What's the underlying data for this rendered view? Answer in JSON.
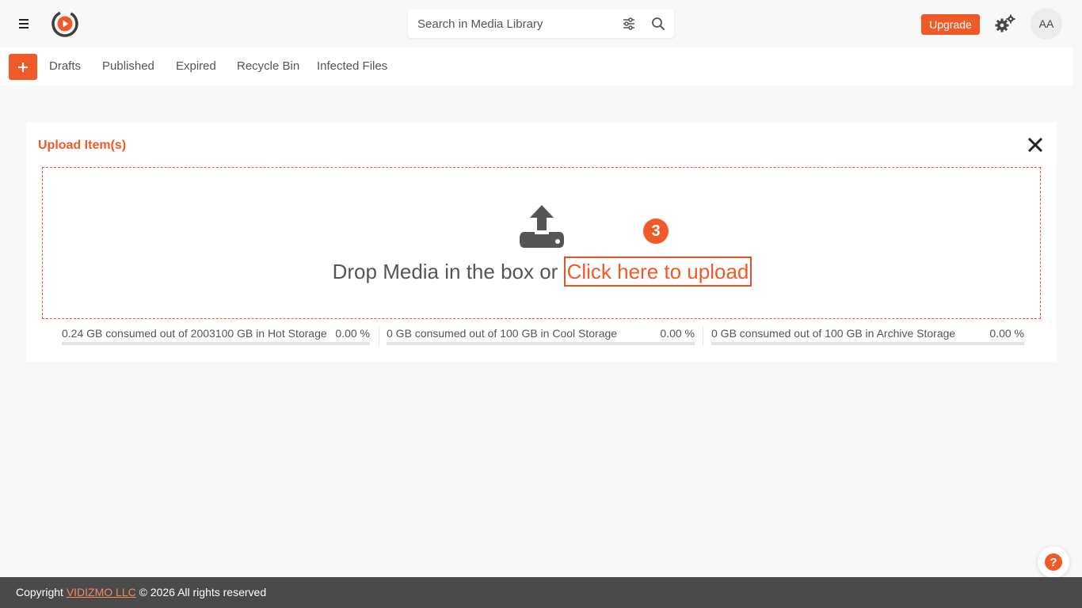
{
  "header": {
    "search": {
      "placeholder": "Search in Media Library"
    },
    "upgrade_label": "Upgrade",
    "avatar_initials": "AA"
  },
  "tabs": [
    {
      "label": "Drafts"
    },
    {
      "label": "Published"
    },
    {
      "label": "Expired"
    },
    {
      "label": "Recycle Bin"
    },
    {
      "label": "Infected Files"
    }
  ],
  "upload_panel": {
    "title": "Upload Item(s)",
    "drop_text": "Drop Media in the box or ",
    "upload_link": "Click here to upload",
    "step_number": "3"
  },
  "storage": [
    {
      "label": "0.24 GB consumed out of 2003100 GB in Hot Storage",
      "percent": "0.00 %",
      "fill_fraction": 0.0
    },
    {
      "label": "0 GB consumed out of 100 GB in Cool Storage",
      "percent": "0.00 %",
      "fill_fraction": 0.0
    },
    {
      "label": "0 GB consumed out of 100 GB in Archive Storage",
      "percent": "0.00 %",
      "fill_fraction": 0.0
    }
  ],
  "help": {
    "label": "?"
  },
  "footer": {
    "prefix": "Copyright ",
    "company": "VIDIZMO LLC",
    "suffix": " © 2026 All rights reserved"
  },
  "colors": {
    "accent": "#f05a28",
    "footer_bg": "#4a4a4a"
  },
  "icons": [
    "menu-icon",
    "logo-icon",
    "filter-icon",
    "search-icon",
    "settings-icon",
    "plus-icon",
    "close-icon",
    "upload-icon",
    "help-icon"
  ]
}
